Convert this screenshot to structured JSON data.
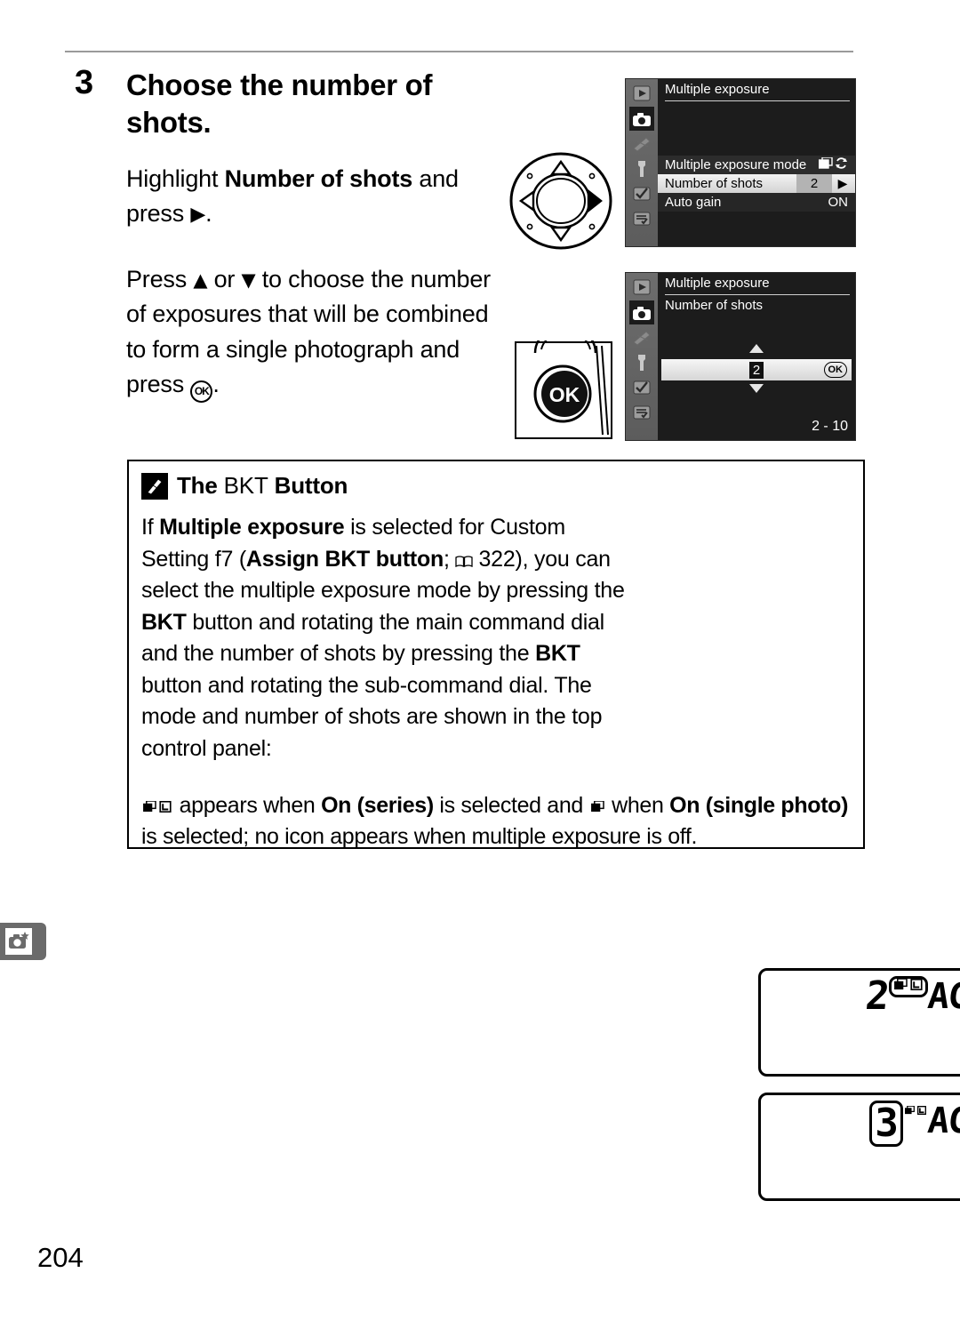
{
  "page": {
    "number": "204",
    "sidebar_tab_icon": "camera-star-icon"
  },
  "step": {
    "number": "3",
    "title": "Choose the number of shots.",
    "paragraph_1_prefix": "Highlight ",
    "paragraph_1_bold": "Number of shots",
    "paragraph_1_suffix": " and press ",
    "paragraph_1_glyph": "▶",
    "paragraph_1_end": ".",
    "paragraph_2_a": "Press ",
    "paragraph_2_up": "▲",
    "paragraph_2_b": " or ",
    "paragraph_2_down": "▼",
    "paragraph_2_c": " to choose the number of exposures that will be combined to form a single photograph and press ",
    "paragraph_2_ok": "OK",
    "paragraph_2_d": "."
  },
  "illustrations": {
    "multi_selector": "multi-selector-dial",
    "ok_button": "ok-button",
    "ok_button_label": "OK"
  },
  "menu_top": {
    "title": "Multiple exposure",
    "rows": [
      {
        "label": "Multiple exposure mode",
        "value": "",
        "icons": "series-loop-icons",
        "selected": false
      },
      {
        "label": "Number of shots",
        "value": "2",
        "arrow": "▶",
        "selected": true
      },
      {
        "label": "Auto gain",
        "value": "ON",
        "selected": false
      }
    ],
    "sidebar_icons": [
      "playback-icon",
      "shooting-menu-icon",
      "pencil-custom-icon",
      "wrench-setup-icon",
      "retouch-icon",
      "my-menu-icon"
    ],
    "sidebar_selected_index": 1
  },
  "menu_bottom": {
    "title": "Multiple exposure",
    "subtitle": "Number of shots",
    "value": "2",
    "ok_label": "OK",
    "range": "2 - 10",
    "sidebar_icons": [
      "playback-icon",
      "shooting-menu-icon",
      "pencil-custom-icon",
      "wrench-setup-icon",
      "retouch-icon",
      "my-menu-icon"
    ],
    "sidebar_selected_index": 1
  },
  "note": {
    "icon": "pencil-note-icon",
    "heading_a": "The ",
    "heading_bkt": "BKT",
    "heading_b": " Button",
    "body": {
      "t1": "If ",
      "b1": "Multiple exposure",
      "t2": " is selected for Custom Setting f7 (",
      "b2": "Assign BKT button",
      "t3": "; ",
      "book_glyph": "☆",
      "t4": " 322), you can select the multiple exposure mode by pressing the ",
      "b3": "BKT",
      "t5": " button and rotating the main command dial and the number of shots by pressing the ",
      "b4": "BKT",
      "t6": " button and rotating the sub-command dial. The mode and number of shots are shown in the top control panel:",
      "page_ref": "322"
    },
    "footer": {
      "f1": " appears when ",
      "fb1": "On (series)",
      "f2": " is selected and ",
      "f3": " when ",
      "fb2": "On (single photo)",
      "f4": " is selected; no icon appears when multiple exposure is off."
    }
  },
  "lcd_panels": [
    {
      "name": "lcd-on-series",
      "digit": "2",
      "mode_icons": "series-pair-icons",
      "suffix": "AG",
      "highlight": "mode-icons"
    },
    {
      "name": "lcd-shot-count",
      "digit": "3",
      "mode_icons": "series-pair-icons",
      "suffix": "AG",
      "highlight": "digit"
    }
  ],
  "colors": {
    "rule": "#9a9a9a",
    "menu_bg": "#1c1c1c",
    "menu_sidebar": "#6d6d6d",
    "selected_row": "#e6e6e6",
    "tab_gray": "#6b6b6b"
  }
}
